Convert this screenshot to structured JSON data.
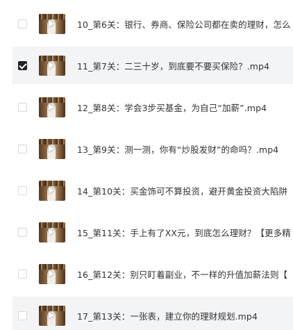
{
  "files": [
    {
      "name": "10_第6关：银行、券商、保险公司都在卖的理财，怎么",
      "checked": false,
      "thumb_icon": "video-thumbnail-icon"
    },
    {
      "name": "11_第7关：二三十岁，到底要不要买保险？.mp4",
      "checked": true,
      "thumb_icon": "video-thumbnail-icon"
    },
    {
      "name": "12_第8关：学会3步买基金，为自己“加薪”.mp4",
      "checked": false,
      "thumb_icon": "video-thumbnail-icon"
    },
    {
      "name": "13_第9关：测一测，你有“炒股发财”的命吗？.mp4",
      "checked": false,
      "thumb_icon": "video-thumbnail-icon"
    },
    {
      "name": "14_第10关：买金饰可不算投资，避开黄金投资大陷阱",
      "checked": false,
      "thumb_icon": "video-thumbnail-icon"
    },
    {
      "name": "15_第11关：手上有了XX元，到底怎么理财？【更多精",
      "checked": false,
      "thumb_icon": "video-thumbnail-icon"
    },
    {
      "name": "16_第12关：别只盯着副业，不一样的升值加薪法则【",
      "checked": false,
      "thumb_icon": "video-thumbnail-icon"
    },
    {
      "name": "17_第13关：一张表，建立你的理财规划.mp4",
      "checked": false,
      "thumb_icon": "video-thumbnail-icon"
    }
  ],
  "colors": {
    "selected_row_bg": "#f3f4f6",
    "checkbox_checked": "#222222",
    "text": "#333333"
  }
}
